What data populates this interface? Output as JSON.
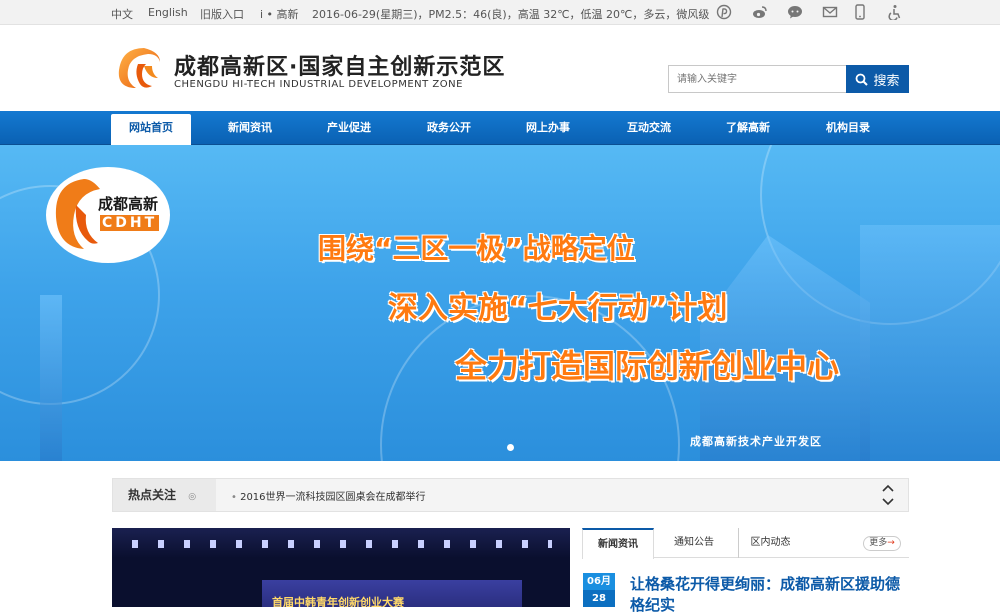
{
  "topbar": {
    "lang_cn": "中文",
    "lang_en": "English",
    "old_site": "旧版入口",
    "i_gaoxin": "i • 高新",
    "weather": "2016-06-29(星期三)，PM2.5：46(良)，高温 32℃，低温 20℃，多云，微风级",
    "icons": [
      "pinterest-icon",
      "weibo-icon",
      "wechat-icon",
      "mail-icon",
      "mobile-icon",
      "accessibility-icon"
    ]
  },
  "header": {
    "title_cn": "成都高新区·国家自主创新示范区",
    "title_en": "CHENGDU HI-TECH INDUSTRIAL DEVELOPMENT ZONE",
    "search_placeholder": "请输入关键字",
    "search_button": "搜索"
  },
  "nav": {
    "items": [
      "网站首页",
      "新闻资讯",
      "产业促进",
      "政务公开",
      "网上办事",
      "互动交流",
      "了解高新",
      "机构目录"
    ],
    "active_index": 0
  },
  "banner": {
    "logo_cn": "成都高新",
    "logo_en": "CDHT",
    "slogan_1": "围绕“三区一极”战略定位",
    "slogan_2": "深入实施“七大行动”计划",
    "slogan_3": "全力打造国际创新创业中心",
    "sign": "成都高新技术产业开发区",
    "colors": {
      "sky": "#3ea3ea",
      "slogan": "#ff7a10"
    }
  },
  "hot": {
    "label": "热点关注",
    "item": "2016世界一流科技园区圆桌会在成都举行"
  },
  "photo": {
    "caption": "首届中韩青年创新创业大赛"
  },
  "news": {
    "tabs": [
      "新闻资讯",
      "通知公告",
      "区内动态"
    ],
    "more": "更多",
    "date_month": "06月",
    "date_day": "28",
    "headline": "让格桑花开得更绚丽：成都高新区援助德格纪实"
  }
}
